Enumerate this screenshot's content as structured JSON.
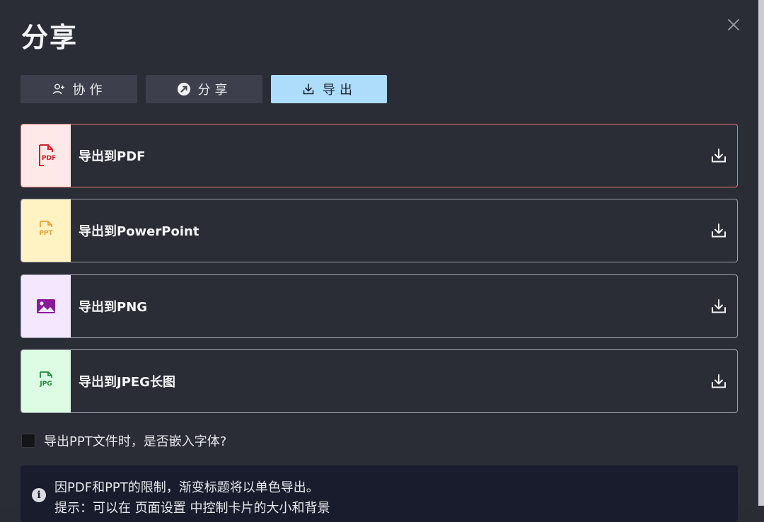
{
  "dialog": {
    "title": "分享",
    "close_icon": "close-icon"
  },
  "tabs": [
    {
      "label": "协作",
      "icon": "add-user-icon",
      "active": false
    },
    {
      "label": "分享",
      "icon": "share-icon",
      "active": false
    },
    {
      "label": "导出",
      "icon": "download-icon",
      "active": true
    }
  ],
  "export_options": [
    {
      "label": "导出到PDF",
      "icon_text": "PDF",
      "icon_color": "#d0202a",
      "thumb_bg": "#ffe8e8",
      "selected": true
    },
    {
      "label": "导出到PowerPoint",
      "icon_text": "PPT",
      "icon_color": "#e8a13a",
      "thumb_bg": "#fff3c4",
      "selected": false
    },
    {
      "label": "导出到PNG",
      "icon_text": "",
      "icon_color": "#8a1a9a",
      "thumb_bg": "#f3e8ff",
      "selected": false
    },
    {
      "label": "导出到JPEG长图",
      "icon_text": "JPG",
      "icon_color": "#1f8a3a",
      "thumb_bg": "#dcfce4",
      "selected": false
    }
  ],
  "embed_fonts": {
    "label": "导出PPT文件时，是否嵌入字体?",
    "checked": false
  },
  "notice": {
    "line1": "因PDF和PPT的限制，渐变标题将以单色导出。",
    "line2": "提示：可以在 页面设置 中控制卡片的大小和背景"
  },
  "colors": {
    "background": "#2b2d36",
    "active_tab": "#aedcfb",
    "selected_border": "#e07a7a"
  }
}
